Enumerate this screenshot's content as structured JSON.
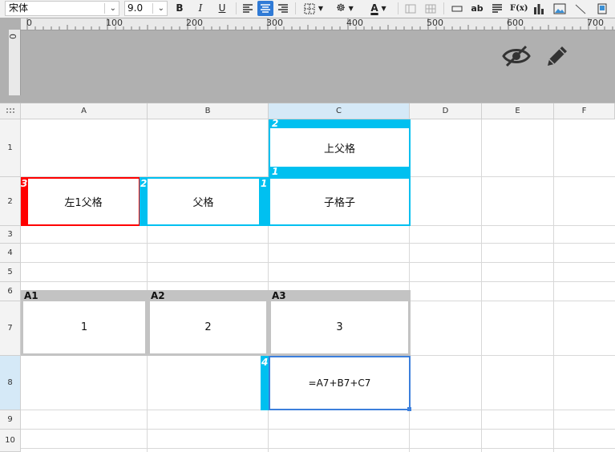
{
  "toolbar": {
    "font_name": "宋体",
    "font_size": "9.0",
    "bold": "B",
    "italic": "I",
    "underline": "U",
    "font_color_label": "A",
    "text_wrap_label": "ab",
    "formula_label": "F(x)"
  },
  "ruler": {
    "h_labels": [
      "0",
      "100",
      "200",
      "300",
      "400",
      "500",
      "600",
      "700"
    ],
    "v_label": "0"
  },
  "grid": {
    "columns": [
      "A",
      "B",
      "C",
      "D",
      "E",
      "F"
    ],
    "rows": [
      "1",
      "2",
      "3",
      "4",
      "5",
      "6",
      "7",
      "8",
      "9",
      "10"
    ]
  },
  "cells": {
    "c1": "上父格",
    "a2": "左1父格",
    "b2": "父格",
    "c2": "子格子",
    "a7": "1",
    "b7": "2",
    "c7": "3",
    "c8": "=A7+B7+C7"
  },
  "tags": {
    "c1_top": "2",
    "c1_bottom": "1",
    "a2": "3",
    "b2": "2",
    "c2": "1",
    "c8": "4"
  },
  "group_headers": {
    "a6": "A1",
    "b6": "A2",
    "c6": "A3"
  },
  "colors": {
    "accent": "#00c0f0",
    "left_parent": "#ff0000",
    "selection": "#3c7fdc",
    "header_bg": "#b0b0b0"
  },
  "icons": [
    "hide-icon",
    "edit-pencil-icon"
  ]
}
